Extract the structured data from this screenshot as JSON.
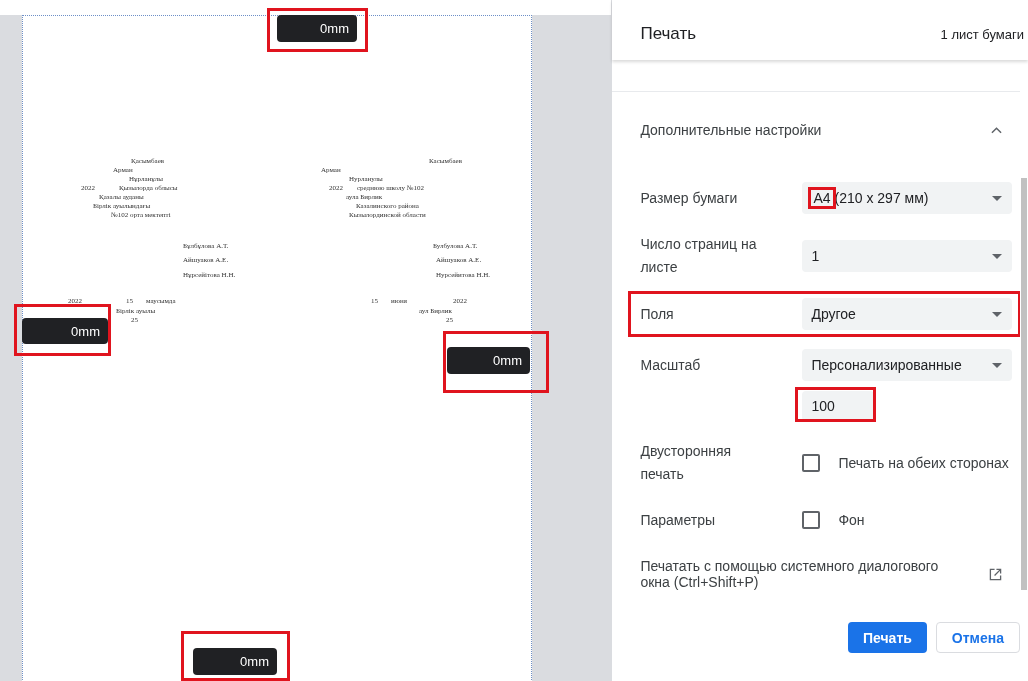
{
  "preview": {
    "margins": [
      {
        "value": "0mm",
        "highlighted": true
      },
      {
        "value": "0mm",
        "highlighted": true
      },
      {
        "value": "0mm",
        "highlighted": true
      },
      {
        "value": "0mm",
        "highlighted": true
      }
    ],
    "lines": [
      "Қасымбаев",
      "Арман",
      "Нұрланұлы",
      "2022",
      "Қызылорда облысы",
      "Қазалы ауданы",
      "Бірлік ауылындағы",
      "№102 орта мектепті",
      "Бұлбұлова А.Т.",
      "Айшуаков А.Е.",
      "Нұрсейітова Н.Н.",
      "2022",
      "15",
      "маусымда",
      "Бірлік ауылы",
      "25",
      "Касымбаев",
      "Арман",
      "Нурланулы",
      "2022",
      "среднюю школу №102",
      "аула Бирлик",
      "Казалинского района",
      "Кызылординской области",
      "Булбулова А.Т.",
      "Айшуаков А.Е.",
      "Нурсейитова Н.Н.",
      "15",
      "июня",
      "2022",
      "аул Бирлик",
      "25"
    ]
  },
  "panel": {
    "title": "Печать",
    "sheets": "1 лист бумаги",
    "section": {
      "title": "Дополнительные настройки",
      "expanded": true
    },
    "settings": [
      {
        "kind": "select",
        "label": "Размер бумаги",
        "value": "A4",
        "value_rest": "(210 x 297 мм)",
        "highlighted": false,
        "value_highlighted": true
      },
      {
        "kind": "select",
        "label": "Число страниц на листе",
        "value": "1",
        "highlighted": false,
        "value_highlighted": false
      },
      {
        "kind": "select",
        "label": "Поля",
        "value": "Другое",
        "highlighted": true,
        "value_highlighted": false
      },
      {
        "kind": "select",
        "label": "Масштаб",
        "value": "Персонализированные",
        "highlighted": false,
        "value_highlighted": false,
        "input": {
          "value": "100",
          "highlighted": true
        }
      },
      {
        "kind": "checkbox",
        "label": "Двусторонняя печать",
        "option": "Печать на обеих сторонах",
        "checked": false
      },
      {
        "kind": "checkbox",
        "label": "Параметры",
        "option": "Фон",
        "checked": false
      },
      {
        "kind": "link",
        "label": "Печатать с помощью системного диалогового окна (Ctrl+Shift+P)"
      }
    ],
    "buttons": [
      {
        "label": "Печать",
        "kind": "primary"
      },
      {
        "label": "Отмена",
        "kind": "secondary"
      }
    ]
  }
}
